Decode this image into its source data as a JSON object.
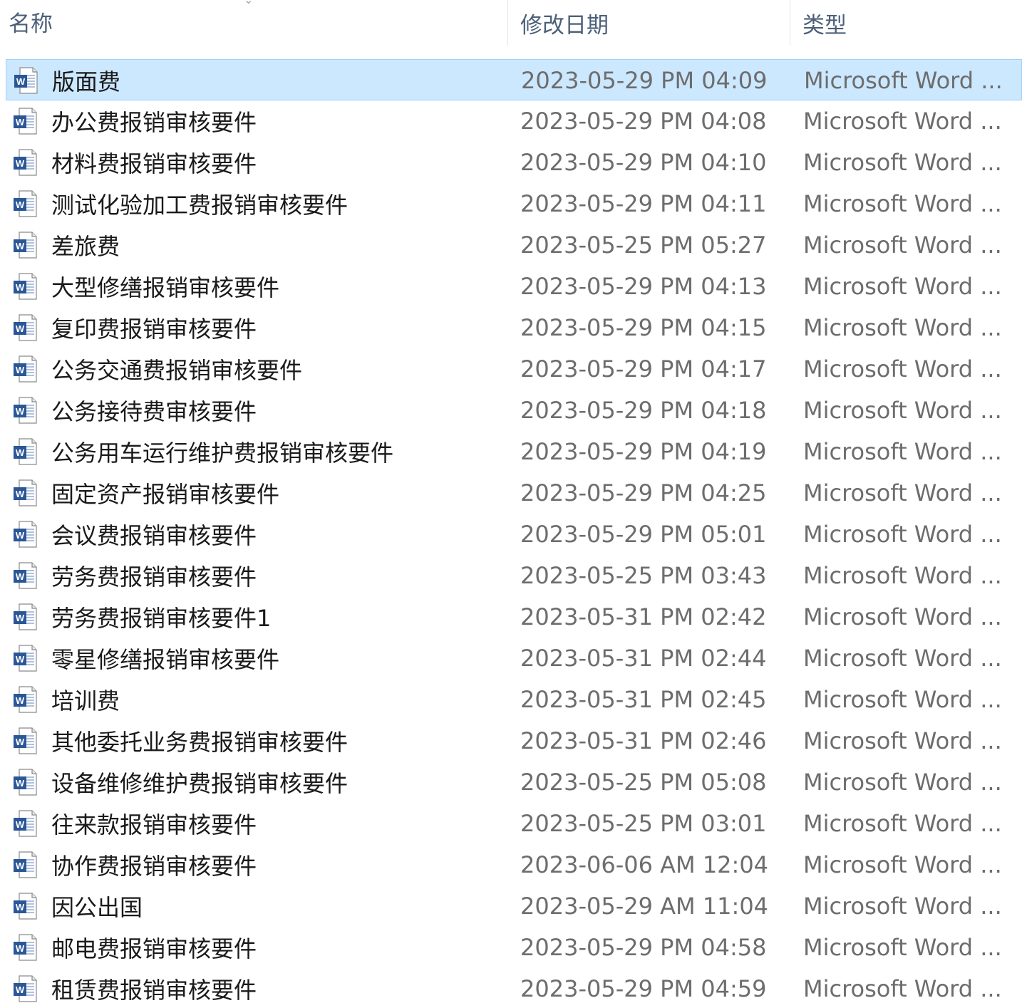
{
  "columns": {
    "name": "名称",
    "date_modified": "修改日期",
    "type": "类型"
  },
  "icon": "word-document-icon",
  "selected_index": 0,
  "colors": {
    "selection_bg": "#cce8ff",
    "selection_border": "#99d1ff",
    "word_blue": "#2b5797"
  },
  "files": [
    {
      "name": "版面费",
      "date": "2023-05-29 PM 04:09",
      "type": "Microsoft Word ..."
    },
    {
      "name": "办公费报销审核要件",
      "date": "2023-05-29 PM 04:08",
      "type": "Microsoft Word ..."
    },
    {
      "name": "材料费报销审核要件",
      "date": "2023-05-29 PM 04:10",
      "type": "Microsoft Word ..."
    },
    {
      "name": "测试化验加工费报销审核要件",
      "date": "2023-05-29 PM 04:11",
      "type": "Microsoft Word ..."
    },
    {
      "name": "差旅费",
      "date": "2023-05-25 PM 05:27",
      "type": "Microsoft Word ..."
    },
    {
      "name": "大型修缮报销审核要件",
      "date": "2023-05-29 PM 04:13",
      "type": "Microsoft Word ..."
    },
    {
      "name": "复印费报销审核要件",
      "date": "2023-05-29 PM 04:15",
      "type": "Microsoft Word ..."
    },
    {
      "name": "公务交通费报销审核要件",
      "date": "2023-05-29 PM 04:17",
      "type": "Microsoft Word ..."
    },
    {
      "name": "公务接待费审核要件",
      "date": "2023-05-29 PM 04:18",
      "type": "Microsoft Word ..."
    },
    {
      "name": "公务用车运行维护费报销审核要件",
      "date": "2023-05-29 PM 04:19",
      "type": "Microsoft Word ..."
    },
    {
      "name": "固定资产报销审核要件",
      "date": "2023-05-29 PM 04:25",
      "type": "Microsoft Word ..."
    },
    {
      "name": "会议费报销审核要件",
      "date": "2023-05-29 PM 05:01",
      "type": "Microsoft Word ..."
    },
    {
      "name": "劳务费报销审核要件",
      "date": "2023-05-25 PM 03:43",
      "type": "Microsoft Word ..."
    },
    {
      "name": "劳务费报销审核要件1",
      "date": "2023-05-31 PM 02:42",
      "type": "Microsoft Word ..."
    },
    {
      "name": "零星修缮报销审核要件",
      "date": "2023-05-31 PM 02:44",
      "type": "Microsoft Word ..."
    },
    {
      "name": "培训费",
      "date": "2023-05-31 PM 02:45",
      "type": "Microsoft Word ..."
    },
    {
      "name": "其他委托业务费报销审核要件",
      "date": "2023-05-31 PM 02:46",
      "type": "Microsoft Word ..."
    },
    {
      "name": "设备维修维护费报销审核要件",
      "date": "2023-05-25 PM 05:08",
      "type": "Microsoft Word ..."
    },
    {
      "name": "往来款报销审核要件",
      "date": "2023-05-25 PM 03:01",
      "type": "Microsoft Word ..."
    },
    {
      "name": "协作费报销审核要件",
      "date": "2023-06-06 AM 12:04",
      "type": "Microsoft Word ..."
    },
    {
      "name": "因公出国",
      "date": "2023-05-29 AM 11:04",
      "type": "Microsoft Word ..."
    },
    {
      "name": "邮电费报销审核要件",
      "date": "2023-05-29 PM 04:58",
      "type": "Microsoft Word ..."
    },
    {
      "name": "租赁费报销审核要件",
      "date": "2023-05-29 PM 04:59",
      "type": "Microsoft Word ..."
    }
  ]
}
